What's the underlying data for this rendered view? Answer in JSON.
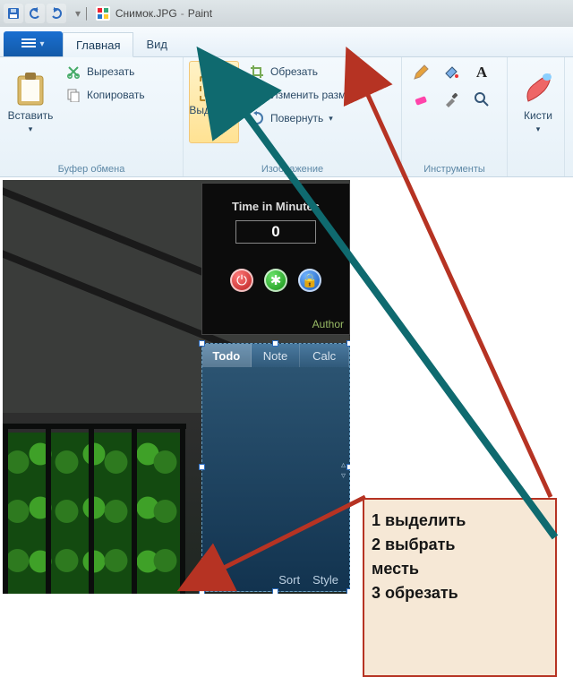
{
  "titlebar": {
    "document": "Снимок.JPG",
    "app": "Paint",
    "separator": "-"
  },
  "tabs": {
    "home": "Главная",
    "view": "Вид"
  },
  "ribbon": {
    "clipboard": {
      "label": "Буфер обмена",
      "paste": "Вставить",
      "cut": "Вырезать",
      "copy": "Копировать"
    },
    "image": {
      "label": "Изображение",
      "select": "Выделить",
      "crop": "Обрезать",
      "resize": "Изменить размер",
      "rotate": "Повернуть"
    },
    "tools": {
      "label": "Инструменты"
    },
    "brushes": {
      "label": "Кисти"
    }
  },
  "gadget1": {
    "title": "Time in Minutes",
    "value": "0",
    "author": "Author"
  },
  "gadget2": {
    "tabs": {
      "todo": "Todo",
      "note": "Note",
      "calc": "Calc"
    },
    "footer": {
      "sort": "Sort",
      "style": "Style"
    }
  },
  "annotation": {
    "line1": "1 выделить",
    "line2": "2 выбрать",
    "line3": "месть",
    "line4": "3 обрезать"
  }
}
